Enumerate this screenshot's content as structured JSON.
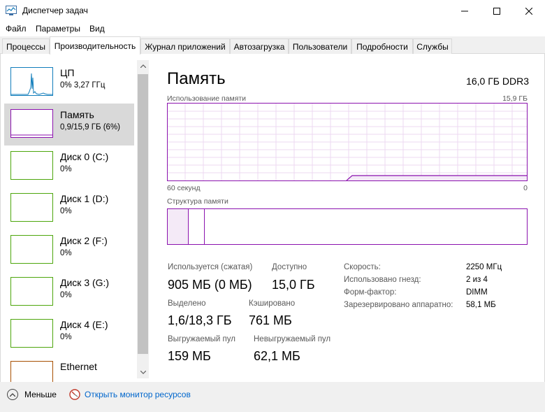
{
  "window": {
    "title": "Диспетчер задач"
  },
  "menu": [
    "Файл",
    "Параметры",
    "Вид"
  ],
  "tabs": [
    "Процессы",
    "Производительность",
    "Журнал приложений",
    "Автозагрузка",
    "Пользователи",
    "Подробности",
    "Службы"
  ],
  "sidebar": {
    "items": [
      {
        "name": "ЦП",
        "sub": "0% 3,27 ГГц",
        "color": "#117dbb"
      },
      {
        "name": "Память",
        "sub": "0,9/15,9 ГБ (6%)",
        "color": "#8b12ae"
      },
      {
        "name": "Диск 0 (C:)",
        "sub": "0%",
        "color": "#4da60c"
      },
      {
        "name": "Диск 1 (D:)",
        "sub": "0%",
        "color": "#4da60c"
      },
      {
        "name": "Диск 2 (F:)",
        "sub": "0%",
        "color": "#4da60c"
      },
      {
        "name": "Диск 3 (G:)",
        "sub": "0%",
        "color": "#4da60c"
      },
      {
        "name": "Диск 4 (E:)",
        "sub": "0%",
        "color": "#4da60c"
      },
      {
        "name": "Ethernet",
        "sub": "",
        "color": "#a74f01"
      }
    ]
  },
  "main": {
    "title": "Память",
    "spec": "16,0 ГБ DDR3",
    "usage_label": "Использование памяти",
    "usage_max": "15,9 ГБ",
    "time_left": "60 секунд",
    "time_right": "0",
    "composition_label": "Структура памяти",
    "stats": {
      "in_use_label": "Используется (сжатая)",
      "in_use_value": "905 МБ (0 МБ)",
      "available_label": "Доступно",
      "available_value": "15,0 ГБ",
      "committed_label": "Выделено",
      "committed_value": "1,6/18,3 ГБ",
      "cached_label": "Кэшировано",
      "cached_value": "761 МБ",
      "paged_label": "Выгружаемый пул",
      "paged_value": "159 МБ",
      "nonpaged_label": "Невыгружаемый пул",
      "nonpaged_value": "62,1 МБ"
    },
    "details": {
      "speed_label": "Скорость:",
      "speed_value": "2250 МГц",
      "slots_label": "Использовано гнезд:",
      "slots_value": "2 из 4",
      "form_label": "Форм-фактор:",
      "form_value": "DIMM",
      "reserved_label": "Зарезервировано аппаратно:",
      "reserved_value": "58,1 МБ"
    }
  },
  "footer": {
    "fewer_label": "Меньше",
    "resmon_label": "Открыть монитор ресурсов"
  },
  "colors": {
    "memory": "#8b12ae",
    "cpu": "#117dbb",
    "disk": "#4da60c",
    "ethernet": "#a74f01",
    "link": "#0066cc"
  }
}
